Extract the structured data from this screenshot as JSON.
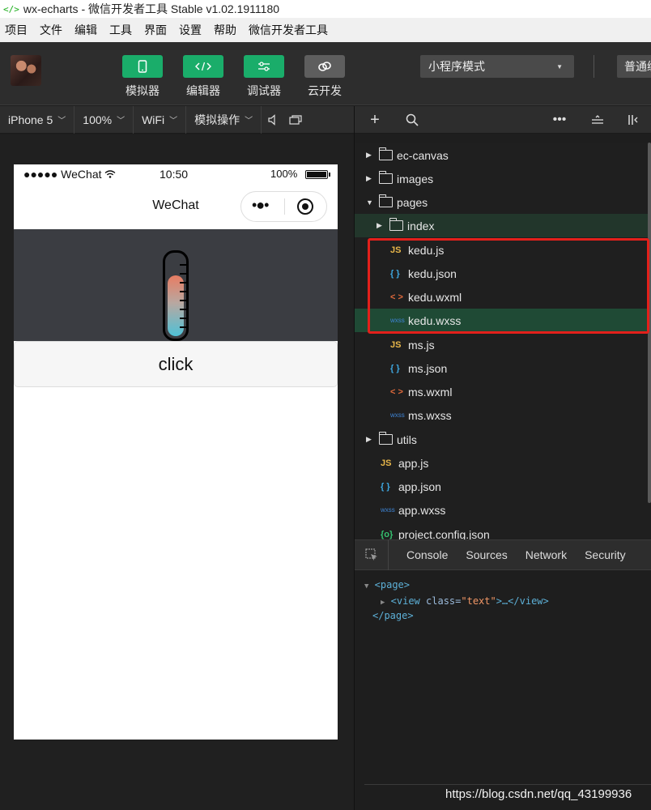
{
  "window": {
    "title": "wx-echarts - 微信开发者工具 Stable v1.02.1911180",
    "icon": "code-icon"
  },
  "menu": [
    "项目",
    "文件",
    "编辑",
    "工具",
    "界面",
    "设置",
    "帮助",
    "微信开发者工具"
  ],
  "toolbar": {
    "buttons": [
      {
        "label": "模拟器",
        "icon": "phone-icon"
      },
      {
        "label": "编辑器",
        "icon": "code-icon"
      },
      {
        "label": "调试器",
        "icon": "sliders-icon"
      },
      {
        "label": "云开发",
        "icon": "cloud-icon"
      }
    ],
    "mode": "小程序模式",
    "compile": "普通编"
  },
  "simulator_bar": {
    "device": "iPhone 5",
    "zoom": "100%",
    "network": "WiFi",
    "operation": "模拟操作"
  },
  "phone": {
    "carrier": "●●●●● WeChat",
    "time": "10:50",
    "battery": "100%",
    "nav_title": "WeChat",
    "capsule_dots": "•●•",
    "button_label": "click",
    "gauge_colors": {
      "top": "#e87c62",
      "bottom": "#4fc1d6",
      "background": "#3b3d42"
    }
  },
  "file_tree": [
    {
      "name": "ec-canvas",
      "kind": "folder",
      "expanded": false
    },
    {
      "name": "images",
      "kind": "folder",
      "expanded": false
    },
    {
      "name": "pages",
      "kind": "folder",
      "expanded": true
    },
    {
      "name": "index",
      "kind": "folder",
      "expanded": false
    },
    {
      "name": "kedu.js",
      "kind": "js",
      "badge": "JS"
    },
    {
      "name": "kedu.json",
      "kind": "json",
      "badge": "{ }"
    },
    {
      "name": "kedu.wxml",
      "kind": "wxml",
      "badge": "< >"
    },
    {
      "name": "kedu.wxss",
      "kind": "wxss",
      "badge": "wxss",
      "selected": true
    },
    {
      "name": "ms.js",
      "kind": "js",
      "badge": "JS"
    },
    {
      "name": "ms.json",
      "kind": "json",
      "badge": "{ }"
    },
    {
      "name": "ms.wxml",
      "kind": "wxml",
      "badge": "< >"
    },
    {
      "name": "ms.wxss",
      "kind": "wxss",
      "badge": "wxss"
    },
    {
      "name": "utils",
      "kind": "folder",
      "expanded": false
    },
    {
      "name": "app.js",
      "kind": "js",
      "badge": "JS"
    },
    {
      "name": "app.json",
      "kind": "json",
      "badge": "{ }"
    },
    {
      "name": "app.wxss",
      "kind": "wxss",
      "badge": "wxss"
    },
    {
      "name": "project.config.json",
      "kind": "config",
      "badge": "{o}"
    }
  ],
  "devtools": {
    "tabs": [
      "Console",
      "Sources",
      "Network",
      "Security"
    ],
    "dom": {
      "open": "<page>",
      "child_tag_open": "<view",
      "child_attr": "class=",
      "child_attr_value": "\"text\"",
      "child_rest": ">…</view>",
      "close": "</page>"
    }
  },
  "watermark": "https://blog.csdn.net/qq_43199936",
  "colors": {
    "accent": "#1aad6a",
    "highlight": "#e3201b",
    "selected_row": "#1f4a35"
  }
}
